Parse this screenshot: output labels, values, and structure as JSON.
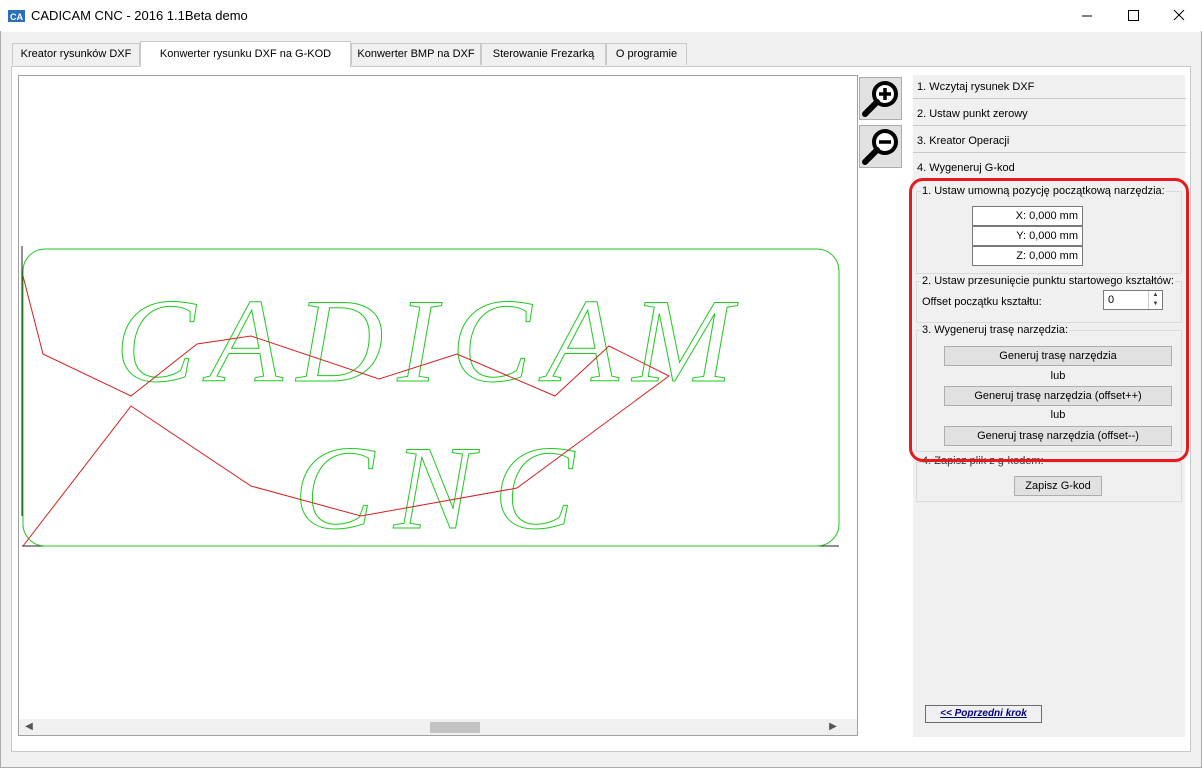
{
  "window": {
    "title": "CADICAM CNC - 2016 1.1Beta demo"
  },
  "tabs": [
    {
      "label": "Kreator rysunków DXF"
    },
    {
      "label": "Konwerter rysunku DXF na G-KOD"
    },
    {
      "label": "Konwerter BMP na DXF"
    },
    {
      "label": "Sterowanie Frezarką"
    },
    {
      "label": "O programie"
    }
  ],
  "canvas": {
    "drawing_text_line1": "CADICAM",
    "drawing_text_line2": "CNC",
    "colors": {
      "shape": "#22c922",
      "toolpath": "#d42020"
    }
  },
  "steps": {
    "step1": "1. Wczytaj rysunek DXF",
    "step2": "2. Ustaw punkt zerowy",
    "step3": "3. Kreator Operacji",
    "step4": "4. Wygeneruj G-kod"
  },
  "section1": {
    "label": "1. Ustaw umowną pozycję początkową narzędzia:",
    "x": "X: 0,000 mm",
    "y": "Y: 0,000 mm",
    "z": "Z: 0,000 mm"
  },
  "section2": {
    "label": "2. Ustaw przesunięcie punktu startowego kształtów:",
    "offset_label": "Offset początku kształtu:",
    "offset_value": "0"
  },
  "section3": {
    "label": "3. Wygeneruj trasę narzędzia:",
    "btn1": "Generuj trasę narzędzia",
    "lub1": "lub",
    "btn2": "Generuj trasę narzędzia (offset++)",
    "lub2": "lub",
    "btn3": "Generuj trasę narzędzia (offset--)"
  },
  "section4": {
    "label": "4. Zapisz plik z g-kodem:",
    "save_button": "Zapisz G-kod"
  },
  "prev_step": "<< Poprzedni krok",
  "highlight_color": "#e8191e"
}
